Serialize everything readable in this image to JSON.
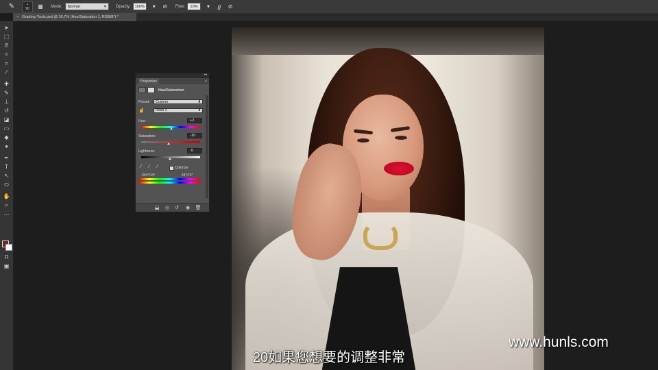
{
  "options_bar": {
    "brush_size": "90",
    "mode_label": "Mode:",
    "mode_value": "Normal",
    "opacity_label": "Opacity:",
    "opacity_value": "100%",
    "flow_label": "Flow:",
    "flow_value": "10%"
  },
  "document_tab": {
    "title": "Grading-Tools.psd @ 16.7% (Hue/Saturation 1, RGB/8*) *"
  },
  "properties_panel": {
    "tab_label": "Properties",
    "adjustment_title": "Hue/Saturation",
    "preset_label": "Preset:",
    "preset_value": "Custom",
    "channel_value": "Reds 2",
    "hue_label": "Hue:",
    "hue_value": "+2",
    "saturation_label": "Saturation:",
    "saturation_value": "-10",
    "lightness_label": "Lightness:",
    "lightness_value": "-5",
    "colorize_label": "Colorize",
    "range_left": "344°/14°",
    "range_right": "44°\\74°"
  },
  "overlay": {
    "subtitle": "20如果您想要的调整非常",
    "watermark": "www.hunls.com"
  }
}
